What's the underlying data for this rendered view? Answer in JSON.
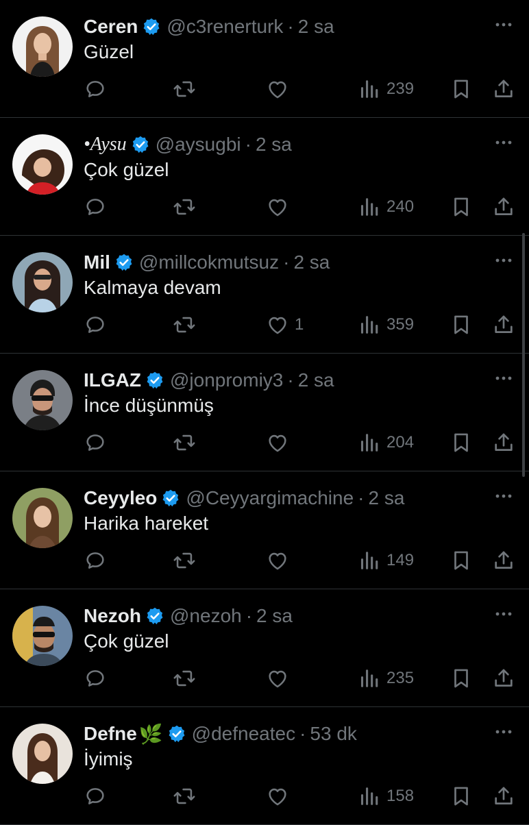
{
  "colors": {
    "background": "#000000",
    "text": "#e7e9ea",
    "muted": "#71767b",
    "verified": "#1d9bf0",
    "divider": "#2f3336"
  },
  "icons": {
    "reply": "speech-bubble-icon",
    "retweet": "retweet-icon",
    "like": "heart-icon",
    "views": "bar-chart-icon",
    "bookmark": "bookmark-icon",
    "share": "share-icon",
    "more": "more-dots-icon",
    "verified": "verified-badge-icon"
  },
  "tweets": [
    {
      "name": "Ceren",
      "handle": "@c3renerturk",
      "time": "2 sa",
      "text": "Güzel",
      "likes": "",
      "views": "239",
      "avatar": "avatar-woman-light-hair"
    },
    {
      "name": "•Aysu",
      "handle": "@aysugbi",
      "time": "2 sa",
      "text": "Çok güzel",
      "likes": "",
      "views": "240",
      "avatar": "avatar-woman-red"
    },
    {
      "name": "Mil",
      "handle": "@millcokmutsuz",
      "time": "2 sa",
      "text": "Kalmaya devam",
      "likes": "1",
      "views": "359",
      "avatar": "avatar-woman-sunglasses"
    },
    {
      "name": "ILGAZ",
      "handle": "@jonpromiy3",
      "time": "2 sa",
      "text": "İnce düşünmüş",
      "likes": "",
      "views": "204",
      "avatar": "avatar-man-sunglasses"
    },
    {
      "name": "Ceyyleo",
      "handle": "@Ceyyargimachine",
      "time": "2 sa",
      "text": "Harika hareket",
      "likes": "",
      "views": "149",
      "avatar": "avatar-woman-outdoor"
    },
    {
      "name": "Nezoh",
      "handle": "@nezoh",
      "time": "2 sa",
      "text": "Çok güzel",
      "likes": "",
      "views": "235",
      "avatar": "avatar-man-selfie"
    },
    {
      "name": "Defne",
      "name_emoji": "🌿",
      "handle": "@defneatec",
      "time": "53 dk",
      "text": "İyimiş",
      "likes": "",
      "views": "158",
      "avatar": "avatar-woman-portrait"
    }
  ]
}
